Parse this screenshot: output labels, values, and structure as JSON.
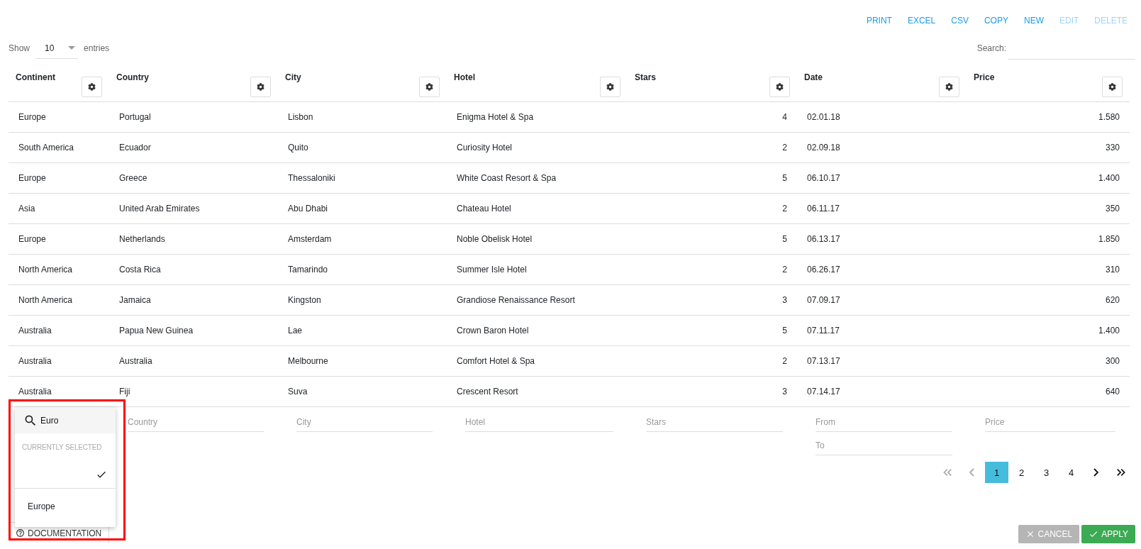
{
  "toolbar": [
    {
      "label": "PRINT",
      "disabled": false
    },
    {
      "label": "EXCEL",
      "disabled": false
    },
    {
      "label": "CSV",
      "disabled": false
    },
    {
      "label": "COPY",
      "disabled": false
    },
    {
      "label": "NEW",
      "disabled": false
    },
    {
      "label": "EDIT",
      "disabled": true
    },
    {
      "label": "DELETE",
      "disabled": true
    }
  ],
  "length": {
    "label": "Show",
    "value": "10",
    "suffix": "entries"
  },
  "search": {
    "label": "Search:"
  },
  "columns": [
    {
      "label": "Continent",
      "kind": "text"
    },
    {
      "label": "Country",
      "kind": "text"
    },
    {
      "label": "City",
      "kind": "text"
    },
    {
      "label": "Hotel",
      "kind": "text"
    },
    {
      "label": "Stars",
      "kind": "number"
    },
    {
      "label": "Date",
      "kind": "text"
    },
    {
      "label": "Price",
      "kind": "number"
    }
  ],
  "rows": [
    [
      "Europe",
      "Portugal",
      "Lisbon",
      "Enigma Hotel & Spa",
      "4",
      "02.01.18",
      "1.580"
    ],
    [
      "South America",
      "Ecuador",
      "Quito",
      "Curiosity Hotel",
      "2",
      "02.09.18",
      "330"
    ],
    [
      "Europe",
      "Greece",
      "Thessaloniki",
      "White Coast Resort & Spa",
      "5",
      "06.10.17",
      "1.400"
    ],
    [
      "Asia",
      "United Arab Emirates",
      "Abu Dhabi",
      "Chateau Hotel",
      "2",
      "06.11.17",
      "350"
    ],
    [
      "Europe",
      "Netherlands",
      "Amsterdam",
      "Noble Obelisk Hotel",
      "5",
      "06.13.17",
      "1.850"
    ],
    [
      "North America",
      "Costa Rica",
      "Tamarindo",
      "Summer Isle Hotel",
      "2",
      "06.26.17",
      "310"
    ],
    [
      "North America",
      "Jamaica",
      "Kingston",
      "Grandiose Renaissance Resort",
      "3",
      "07.09.17",
      "620"
    ],
    [
      "Australia",
      "Papua New Guinea",
      "Lae",
      "Crown Baron Hotel",
      "5",
      "07.11.17",
      "1.400"
    ],
    [
      "Australia",
      "Australia",
      "Melbourne",
      "Comfort Hotel & Spa",
      "2",
      "07.13.17",
      "300"
    ],
    [
      "Australia",
      "Fiji",
      "Suva",
      "Crescent Resort",
      "3",
      "07.14.17",
      "640"
    ]
  ],
  "filters": [
    {
      "kind": "select"
    },
    {
      "kind": "text",
      "placeholders": [
        "Country"
      ]
    },
    {
      "kind": "text",
      "placeholders": [
        "City"
      ]
    },
    {
      "kind": "text",
      "placeholders": [
        "Hotel"
      ]
    },
    {
      "kind": "text",
      "placeholders": [
        "Stars"
      ]
    },
    {
      "kind": "range",
      "placeholders": [
        "From",
        "To"
      ]
    },
    {
      "kind": "text",
      "placeholders": [
        "Price"
      ]
    }
  ],
  "dropdown": {
    "search_value": "Euro",
    "section": "CURRENTLY SELECTED",
    "current": [
      {
        "checked": true
      }
    ],
    "options": [
      {
        "label": "Europe",
        "selected": false
      }
    ]
  },
  "pagination": {
    "first": {
      "disabled": true
    },
    "prev": {
      "disabled": true
    },
    "pages": [
      {
        "label": "1",
        "selected": true
      },
      {
        "label": "2",
        "selected": false
      },
      {
        "label": "3",
        "selected": false
      },
      {
        "label": "4",
        "selected": false
      }
    ],
    "next": {
      "disabled": false
    },
    "last": {
      "disabled": false
    }
  },
  "footer": {
    "documentation": "DOCUMENTATION",
    "cancel": {
      "label": "CANCEL",
      "disabled": true
    },
    "apply": {
      "label": "APPLY",
      "disabled": false
    }
  }
}
